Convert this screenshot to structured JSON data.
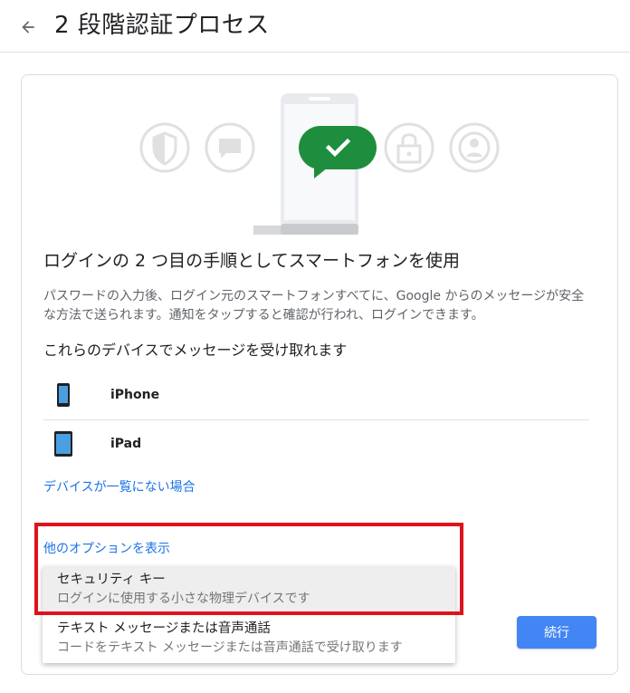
{
  "header": {
    "title": "2 段階認証プロセス",
    "back_icon": "arrow-left-icon"
  },
  "colors": {
    "accent": "#1a73e8",
    "button": "#4285f4",
    "success_green": "#1e8e3e",
    "highlight": "#e0121b"
  },
  "main": {
    "heading": "ログインの 2 つ目の手順としてスマートフォンを使用",
    "description": "パスワードの入力後、ログイン元のスマートフォンすべてに、Google からのメッセージが安全な方法で送られます。通知をタップすると確認が行われ、ログインできます。",
    "devices_heading": "これらのデバイスでメッセージを受け取れます",
    "devices": [
      {
        "name": "iPhone",
        "icon": "smartphone-icon"
      },
      {
        "name": "iPad",
        "icon": "tablet-icon"
      }
    ],
    "device_missing_link": "デバイスが一覧にない場合",
    "more_options_link": "他のオプションを表示",
    "continue_label": "続行"
  },
  "options_menu": {
    "items": [
      {
        "title": "セキュリティ キー",
        "description": "ログインに使用する小さな物理デバイスです"
      },
      {
        "title": "テキスト メッセージまたは音声通話",
        "description": "コードをテキスト メッセージまたは音声通話で受け取ります"
      }
    ]
  }
}
